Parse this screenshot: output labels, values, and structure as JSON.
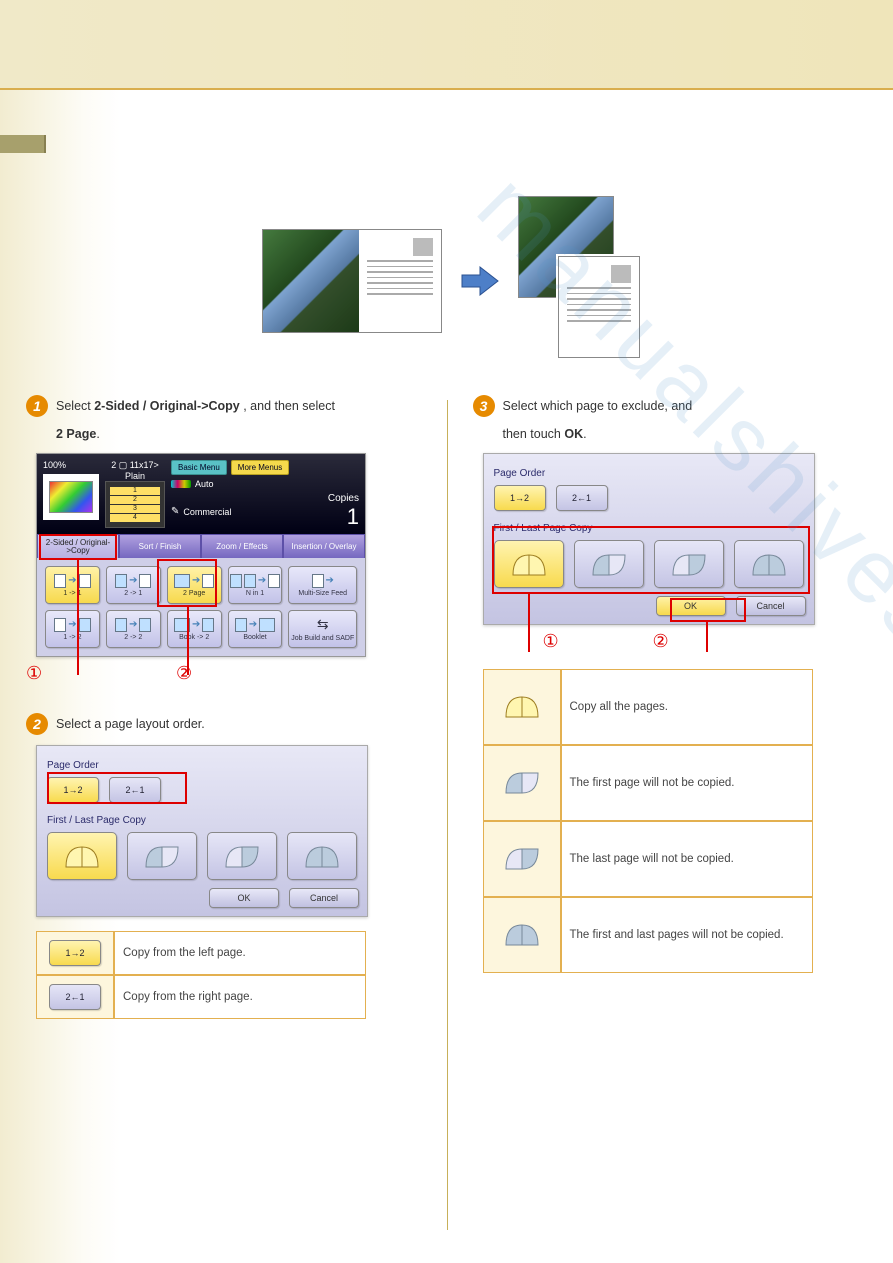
{
  "hero": {
    "watermark": "manualshives.com"
  },
  "step1": {
    "num": "1",
    "text_leader": "Select",
    "text_mid": "2-Sided / Original->Copy",
    "text_sep": ", and then select",
    "text_tail": "2 Page",
    "text_end": ".",
    "marker1": "①",
    "marker2": "②"
  },
  "panel": {
    "zoom": "100%",
    "tray_label": "2 ▢ 11x17>",
    "plain": "Plain",
    "basic_menu": "Basic Menu",
    "more_menus": "More Menus",
    "auto": "Auto",
    "commercial": "Commercial",
    "copies_label": "Copies",
    "copies_n": "1",
    "trays": [
      "1",
      "2",
      "3",
      "4"
    ],
    "tabs": [
      "2-Sided / Original->Copy",
      "Sort / Finish",
      "Zoom / Effects",
      "Insertion / Overlay"
    ],
    "buttons_row1": [
      "1 -> 1",
      "2 -> 1",
      "2 Page",
      "N in 1",
      "Multi-Size Feed"
    ],
    "buttons_row2": [
      "1 -> 2",
      "2 -> 2",
      "Book -> 2",
      "Booklet",
      "Job Build and SADF"
    ]
  },
  "step2": {
    "num": "2",
    "text": "Select a page layout order."
  },
  "dialogA": {
    "label_pageorder": "Page Order",
    "chip12": "1→2",
    "chip21": "2←1",
    "label_flpc": "First / Last Page Copy",
    "ok": "OK",
    "cancel": "Cancel"
  },
  "tableA": {
    "r1": "Copy from the left page.",
    "r2": "Copy from the right page."
  },
  "step3r": {
    "num": "3",
    "leader": "Select which page to exclude, and",
    "mid": "then touch",
    "btn": "OK",
    "end": ".",
    "marker1": "①",
    "marker2": "②"
  },
  "dialogB": {
    "label_pageorder": "Page Order",
    "chip12": "1→2",
    "chip21": "2←1",
    "label_flpc": "First / Last Page Copy",
    "ok": "OK",
    "cancel": "Cancel"
  },
  "tableB": {
    "r1": "Copy all the pages.",
    "r2": "The first page will not be copied.",
    "r3": "The last page will not be copied.",
    "r4": "The first and last pages will not be copied."
  }
}
